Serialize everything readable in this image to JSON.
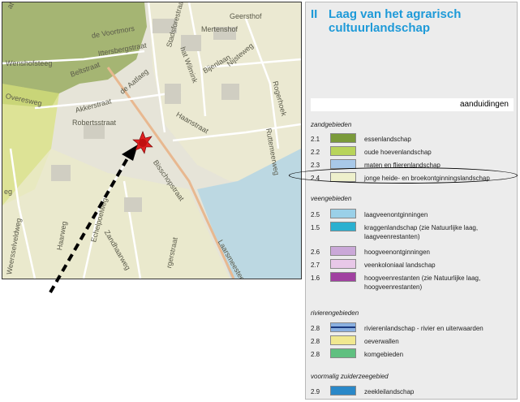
{
  "map": {
    "streets": [
      {
        "id": "s1",
        "text": "de Voortmors"
      },
      {
        "id": "s2",
        "text": "Ittersbergstraat"
      },
      {
        "id": "s3",
        "text": "Wenshofsteeg"
      },
      {
        "id": "s4",
        "text": "Beltstraat"
      },
      {
        "id": "s5",
        "text": "Overesweg"
      },
      {
        "id": "s6",
        "text": "Akkerstraat"
      },
      {
        "id": "s7",
        "text": "de Aatlaeg"
      },
      {
        "id": "s8",
        "text": "Robertsstraat"
      },
      {
        "id": "s9",
        "text": "Stadsforestraat"
      },
      {
        "id": "s10",
        "text": "Mertenshof"
      },
      {
        "id": "s11",
        "text": "Geersthof"
      },
      {
        "id": "s12",
        "text": "hat Wilmink"
      },
      {
        "id": "s13",
        "text": "Bijenlaan"
      },
      {
        "id": "s14",
        "text": "Nijsteweg"
      },
      {
        "id": "s15",
        "text": "Haanstraat"
      },
      {
        "id": "s16",
        "text": "Rogerhoek"
      },
      {
        "id": "s17",
        "text": "Bisschopstraat"
      },
      {
        "id": "s18",
        "text": "Ruttemeerweg"
      },
      {
        "id": "s19",
        "text": "Weersselveldweg"
      },
      {
        "id": "s20",
        "text": "Echelpoelweg"
      },
      {
        "id": "s21",
        "text": "Haarweg"
      },
      {
        "id": "s22",
        "text": "Zandhaarweg"
      },
      {
        "id": "s23",
        "text": "Laarsmeesteeg"
      },
      {
        "id": "s24",
        "text": "rgerstraat"
      },
      {
        "id": "s25",
        "text": "eg"
      },
      {
        "id": "s26",
        "text": "at"
      }
    ]
  },
  "legend": {
    "title_num": "II",
    "title_line1": "Laag van het agrarisch",
    "title_line2": "cultuurlandschap",
    "annotations_label": "aanduidingen",
    "groups": [
      {
        "id": "g1",
        "label": "zandgebieden",
        "items": [
          {
            "code": "2.1",
            "label": "essenlandschap",
            "color": "#7a9a3a"
          },
          {
            "code": "2.2",
            "label": "oude hoevenlandschap",
            "color": "#b8d45a"
          },
          {
            "code": "2.3",
            "label": "maten en flierenlandschap",
            "color": "#a8c8e8"
          },
          {
            "code": "2.4",
            "label": "jonge heide- en broekontginningslandschap",
            "color": "#eef0cc"
          }
        ]
      },
      {
        "id": "g2",
        "label": "veengebieden",
        "items": [
          {
            "code": "2.5",
            "label": "laagveenontginningen",
            "color": "#9ad0e8"
          },
          {
            "code": "1.5",
            "label": "kraggenlandschap  (zie Natuurlijke laag, laagveenrestanten)",
            "color": "#2ab0d0"
          },
          {
            "code": "2.6",
            "label": "hoogveenontginningen",
            "color": "#caa8d8"
          },
          {
            "code": "2.7",
            "label": "veenkoloniaal landschap",
            "color": "#e8c8e8"
          },
          {
            "code": "1.6",
            "label": "hoogveenrestanten (zie Natuurlijke laag, hoogveenrestanten)",
            "color": "#a040a0"
          }
        ]
      },
      {
        "id": "g3",
        "label": "rivierengebieden",
        "items": [
          {
            "code": "2.8",
            "label": "rivierenlandschap - rivier en uiterwaarden",
            "color": "#4a78c8"
          },
          {
            "code": "2.8",
            "label": "oeverwallen",
            "color": "#f0e890"
          },
          {
            "code": "2.8",
            "label": "komgebieden",
            "color": "#60c080"
          }
        ]
      },
      {
        "id": "g4",
        "label": "voormalig zuiderzeegebied",
        "items": [
          {
            "code": "2.9",
            "label": "zeekleilandschap",
            "color": "#2a88c8"
          }
        ]
      }
    ]
  }
}
